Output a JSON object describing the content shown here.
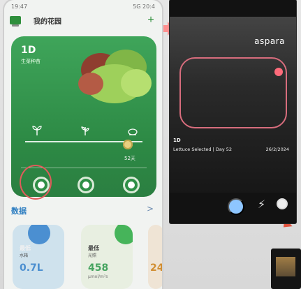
{
  "status_time": "19:47",
  "status_right": "5G 20:4",
  "app": {
    "title": "我的花园",
    "add_label": "+"
  },
  "plant_card": {
    "days": "1D",
    "stage": "生菜种苗",
    "days_label": "52天"
  },
  "data_section": {
    "title": "数据",
    "arrow": ">"
  },
  "metrics": [
    {
      "title": "最低",
      "sub": "水箱",
      "value": "0.7L",
      "unit": ""
    },
    {
      "title": "最低",
      "sub": "光照",
      "value": "458",
      "unit": "μmol/m²s"
    },
    {
      "title": "",
      "sub": "",
      "value": "24",
      "unit": ""
    }
  ],
  "camera": {
    "brand": "aspara",
    "day_label": "1D",
    "crop_line": "Lettuce Selected | Day 52",
    "date": "26/2/2024"
  },
  "colors": {
    "accent_green": "#2f8f3c",
    "card_green": "#3fa55a",
    "annotation_red": "#e05b5b",
    "frame_pink": "#d86d7d"
  }
}
